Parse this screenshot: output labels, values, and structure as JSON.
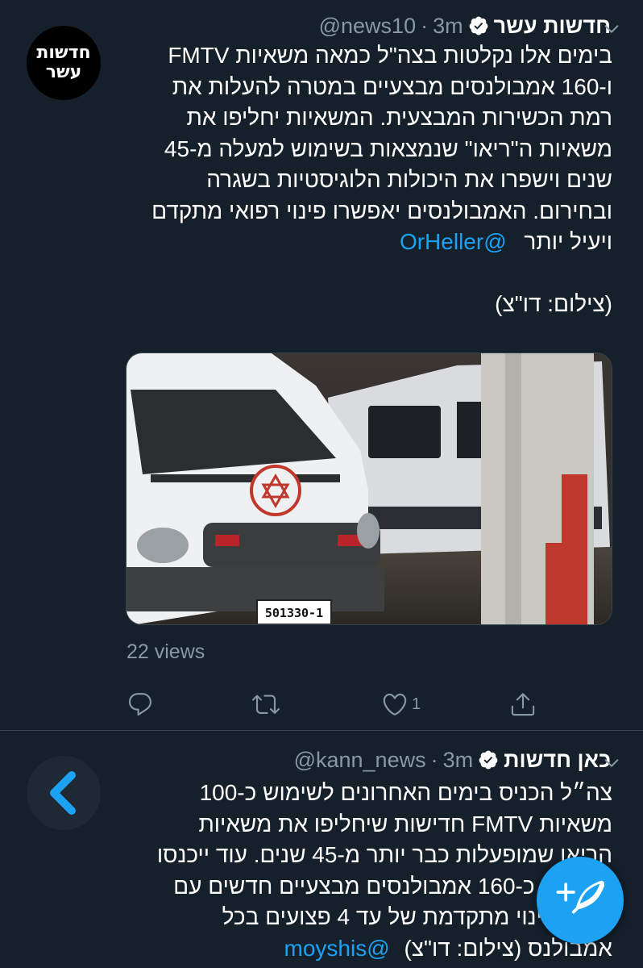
{
  "tweets": [
    {
      "avatar_text": "חדשות עשר",
      "name": "חדשות עשר",
      "handle": "@news10",
      "separator": "·",
      "time": "3m",
      "lines": [
        "בימים אלו נקלטות בצה\"ל כמאה משאיות FMTV",
        "ו-160 אמבולנסים מבצעיים במטרה להעלות את",
        "רמת הכשירות המבצעית. המשאיות יחליפו את",
        "משאיות ה\"ריאו\" שנמצאות בשימוש למעלה מ-45",
        "שנים וישפרו את היכולות הלוגיסטיות בשגרה",
        "ובחירום. האמבולנסים יאפשרו פינוי רפואי מתקדם"
      ],
      "last_line_text": "ויעיל יותר",
      "mention": "@OrHeller",
      "credit": "(צילום: דו\"צ)",
      "plate_text": "501330-1",
      "views": "22 views",
      "like_count": "1",
      "icons": [
        "reply-icon",
        "retweet-icon",
        "like-icon",
        "share-icon"
      ]
    },
    {
      "name": "כאן חדשות",
      "handle": "@kann_news",
      "separator": "·",
      "time": "3m",
      "lines": [
        "צה״ל הכניס בימים האחרונים לשימוש כ-100",
        "משאיות FMTV חדישות שיחליפו את משאיות",
        "הריאו שמופעלות כבר יותר מ-45 שנים. עוד ייכנסו",
        "לשימוש כ-160 אמבולנסים מבצעיים חדשים עם",
        "יכולת פינוי מתקדמת של עד 4 פצועים בכל"
      ],
      "last_line_text": "אמבולנס (צילום: דו\"צ)",
      "mention": "@moyshis"
    }
  ],
  "colors": {
    "background": "#15202b",
    "accent": "#1da1f2",
    "muted": "#8899a6",
    "divider": "#38444d"
  },
  "fab_icon": "compose-tweet-icon"
}
